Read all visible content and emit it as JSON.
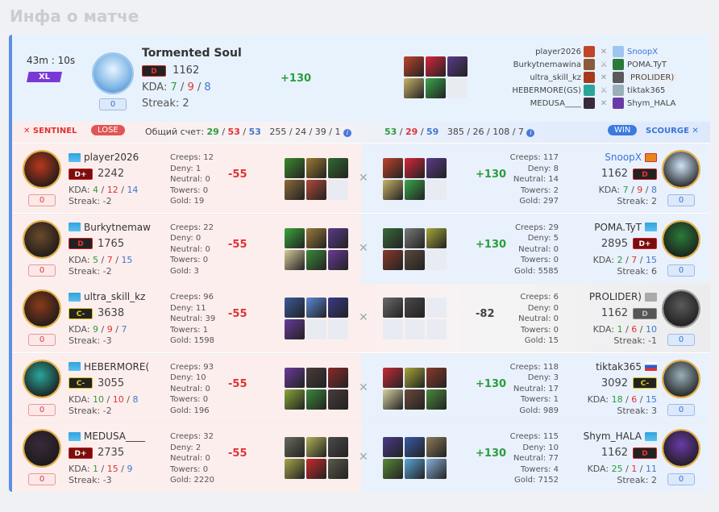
{
  "page_title": "Инфа о матче",
  "header": {
    "duration": "43m : 10s",
    "mode": "XL",
    "player": {
      "name": "Tormented Soul",
      "rank": "D",
      "mmr": "1162",
      "kda_label": "KDA:",
      "k": "7",
      "d": "9",
      "a": "8",
      "streak": "Streak: 2",
      "badge": "0",
      "delta": "+130"
    },
    "items": [
      "#c0442a",
      "#d8263b",
      "#5a3a8a",
      "#c9b26a",
      "#3aa64a",
      ""
    ],
    "list": [
      {
        "left": "player2026",
        "right": "SnoopX",
        "right_link": true
      },
      {
        "left": "Burkytnemawina",
        "right": "POMA.TyT"
      },
      {
        "left": "ultra_skill_kz",
        "right": "PROLIDER)",
        "right_hl": true
      },
      {
        "left": "HEBERMORE(GS)",
        "right": "tiktak365"
      },
      {
        "left": "MEDUSA____",
        "right": "Shym_HALA"
      }
    ]
  },
  "scorebar": {
    "sentinel": "SENTINEL",
    "lose": "LOSE",
    "total_label": "Общий счет:",
    "left_k": "29",
    "left_d": "53",
    "left_a": "53",
    "left_stats": "255 / 24 / 39 / 1",
    "right_k": "53",
    "right_d": "29",
    "right_a": "59",
    "right_stats": "385 / 26 / 108 / 7",
    "win": "WIN",
    "scourge": "SCOURGE"
  },
  "rows": [
    {
      "left": {
        "name": "player2026",
        "flag": "kz",
        "rank": "D+",
        "rank_cls": "Dp",
        "mmr": "2242",
        "k": "4",
        "d": "12",
        "a": "14",
        "streak": "Streak: -2",
        "badge": "0",
        "av": "#b8381c",
        "creeps": "Creeps: 12",
        "deny": "Deny: 1",
        "neutral": "Neutral: 0",
        "towers": "Towers: 0",
        "gold": "Gold: 19",
        "delta": "-55",
        "items": [
          "#3c8a2c",
          "#9a7a30",
          "#2f6a30",
          "#8a6a3a",
          "#b04a3a",
          ""
        ]
      },
      "right": {
        "name": "SnoopX",
        "flag": "kg",
        "link": true,
        "rank": "D",
        "rank_cls": "D",
        "mmr": "1162",
        "k": "7",
        "d": "9",
        "a": "8",
        "streak": "Streak: 2",
        "badge": "0",
        "av": "#cfe3f7",
        "creeps": "Creeps: 117",
        "deny": "Deny: 8",
        "neutral": "Neutral: 14",
        "towers": "Towers: 2",
        "gold": "Gold: 297",
        "delta": "+130",
        "items": [
          "#c0442a",
          "#d8263b",
          "#5a3a8a",
          "#c9b26a",
          "#3aa64a",
          ""
        ]
      }
    },
    {
      "left": {
        "name": "Burkytnemaw",
        "flag": "kz",
        "rank": "D",
        "rank_cls": "D",
        "mmr": "1765",
        "k": "5",
        "d": "7",
        "a": "15",
        "streak": "Streak: -2",
        "badge": "0",
        "av": "#6a4a2a",
        "creeps": "Creeps: 22",
        "deny": "Deny: 0",
        "neutral": "Neutral: 0",
        "towers": "Towers: 0",
        "gold": "Gold: 3",
        "delta": "-55",
        "items": [
          "#3aa63a",
          "#9a7a3a",
          "#5a3a8a",
          "#d8c89a",
          "#3a8a3a",
          "#6a3a9a"
        ]
      },
      "right": {
        "name": "POMA.TyT",
        "flag": "kz",
        "rank": "D+",
        "rank_cls": "Dp",
        "mmr": "2895",
        "k": "2",
        "d": "7",
        "a": "15",
        "streak": "Streak: 6",
        "badge": "0",
        "av": "#2a7a3a",
        "creeps": "Creeps: 29",
        "deny": "Deny: 5",
        "neutral": "Neutral: 0",
        "towers": "Towers: 0",
        "gold": "Gold: 5585",
        "delta": "+130",
        "items": [
          "#3a6a3a",
          "#7a7a7a",
          "#a6a63a",
          "#8a3a2a",
          "#5a4a3a",
          ""
        ]
      }
    },
    {
      "left": {
        "name": "ultra_skill_kz",
        "flag": "kz",
        "rank": "C-",
        "rank_cls": "Cm",
        "mmr": "3638",
        "k": "9",
        "d": "9",
        "a": "7",
        "streak": "Streak: -3",
        "badge": "0",
        "av": "#8a3a1a",
        "creeps": "Creeps: 96",
        "deny": "Deny: 11",
        "neutral": "Neutral: 39",
        "towers": "Towers: 1",
        "gold": "Gold: 1598",
        "delta": "-55",
        "items": [
          "#3a5a9a",
          "#5a8ad8",
          "#3a3a8a",
          "#6a3a9a",
          "",
          ""
        ]
      },
      "gray": true,
      "right": {
        "name": "PROLIDER)",
        "flag": "gr",
        "rank": "D",
        "rank_cls": "Dg",
        "mmr": "1162",
        "k": "1",
        "d": "6",
        "a": "10",
        "streak": "Streak: -1",
        "badge": "0",
        "av": "#5a5a5a",
        "creeps": "Creeps: 6",
        "deny": "Deny: 0",
        "neutral": "Neutral: 0",
        "towers": "Towers: 0",
        "gold": "Gold: 15",
        "delta": "-82",
        "items": [
          "#6a6a6a",
          "#4a4a4a",
          "",
          "",
          "",
          ""
        ]
      }
    },
    {
      "left": {
        "name": "HEBERMORE(",
        "flag": "kz",
        "rank": "C-",
        "rank_cls": "Cm",
        "mmr": "3055",
        "k": "10",
        "d": "10",
        "a": "8",
        "streak": "Streak: -2",
        "badge": "0",
        "av": "#2aa69a",
        "creeps": "Creeps: 93",
        "deny": "Deny: 10",
        "neutral": "Neutral: 0",
        "towers": "Towers: 0",
        "gold": "Gold: 196",
        "delta": "-55",
        "items": [
          "#6a3a9a",
          "#4a3a3a",
          "#8a2a2a",
          "#8aa63a",
          "#3a8a3a",
          "#4a3a3a"
        ]
      },
      "right": {
        "name": "tiktak365",
        "flag": "ru",
        "rank": "C-",
        "rank_cls": "Cm",
        "mmr": "3092",
        "k": "18",
        "d": "6",
        "a": "15",
        "streak": "Streak: 3",
        "badge": "0",
        "av": "#9ab0b8",
        "creeps": "Creeps: 118",
        "deny": "Deny: 3",
        "neutral": "Neutral: 17",
        "towers": "Towers: 1",
        "gold": "Gold: 989",
        "delta": "+130",
        "items": [
          "#c82a3a",
          "#a6a63a",
          "#8a3a2a",
          "#d8d0a0",
          "#6a4a3a",
          "#4a8a3a"
        ]
      }
    },
    {
      "left": {
        "name": "MEDUSA____",
        "flag": "kz",
        "rank": "D+",
        "rank_cls": "Dp",
        "mmr": "2735",
        "k": "1",
        "d": "15",
        "a": "9",
        "streak": "Streak: -3",
        "badge": "0",
        "av": "#3a2a3a",
        "creeps": "Creeps: 32",
        "deny": "Deny: 2",
        "neutral": "Neutral: 0",
        "towers": "Towers: 0",
        "gold": "Gold: 2220",
        "delta": "-55",
        "items": [
          "#6a6a5a",
          "#b0b05a",
          "#4a4a4a",
          "#a6a64a",
          "#c82a2a",
          "#5a5a4a"
        ]
      },
      "right": {
        "name": "Shym_HALA",
        "flag": "kz",
        "rank": "D",
        "rank_cls": "D",
        "mmr": "1162",
        "k": "25",
        "d": "1",
        "a": "11",
        "streak": "Streak: 2",
        "badge": "0",
        "av": "#6a3aa6",
        "creeps": "Creeps: 115",
        "deny": "Deny: 10",
        "neutral": "Neutral: 77",
        "towers": "Towers: 4",
        "gold": "Gold: 7152",
        "delta": "+130",
        "items": [
          "#4a3a8a",
          "#3a5aa6",
          "#8a7a5a",
          "#5a8a3a",
          "#5aa6d8",
          "#8ab0d8"
        ]
      }
    }
  ]
}
